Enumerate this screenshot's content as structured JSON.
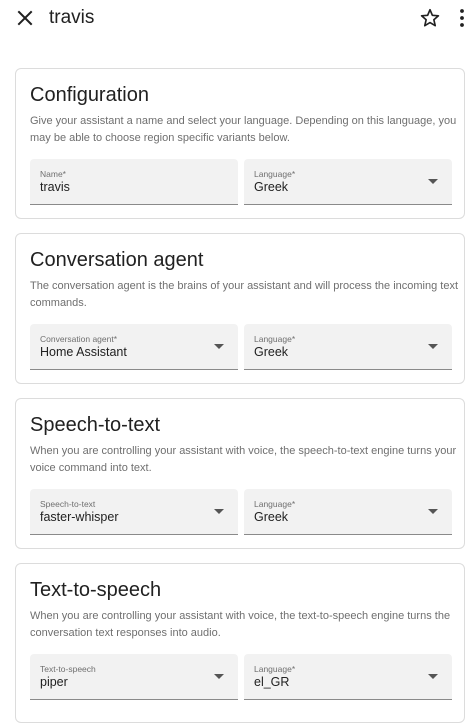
{
  "header": {
    "title": "travis"
  },
  "icons": {
    "close": "close-icon",
    "star": "star-outline-icon",
    "menu": "more-vertical-icon",
    "dropdown": "caret-down-icon"
  },
  "colors": {
    "field_background": "#f2f2f2",
    "card_border": "#dcdcdc",
    "description_text": "#6f6f6f"
  },
  "sections": [
    {
      "title": "Configuration",
      "description": "Give your assistant a name and select your language. Depending on this language, you may be able to choose region specific variants below.",
      "fields": [
        {
          "label": "Name*",
          "value": "travis",
          "dropdown": false
        },
        {
          "label": "Language*",
          "value": "Greek",
          "dropdown": true
        }
      ]
    },
    {
      "title": "Conversation agent",
      "description": "The conversation agent is the brains of your assistant and will process the incoming text commands.",
      "fields": [
        {
          "label": "Conversation agent*",
          "value": "Home Assistant",
          "dropdown": true
        },
        {
          "label": "Language*",
          "value": "Greek",
          "dropdown": true
        }
      ]
    },
    {
      "title": "Speech-to-text",
      "description": "When you are controlling your assistant with voice, the speech-to-text engine turns your voice command into text.",
      "fields": [
        {
          "label": "Speech-to-text",
          "value": "faster-whisper",
          "dropdown": true
        },
        {
          "label": "Language*",
          "value": "Greek",
          "dropdown": true
        }
      ]
    },
    {
      "title": "Text-to-speech",
      "description": "When you are controlling your assistant with voice, the text-to-speech engine turns the conversation text responses into audio.",
      "fields": [
        {
          "label": "Text-to-speech",
          "value": "piper",
          "dropdown": true
        },
        {
          "label": "Language*",
          "value": "el_GR",
          "dropdown": true
        }
      ]
    }
  ]
}
